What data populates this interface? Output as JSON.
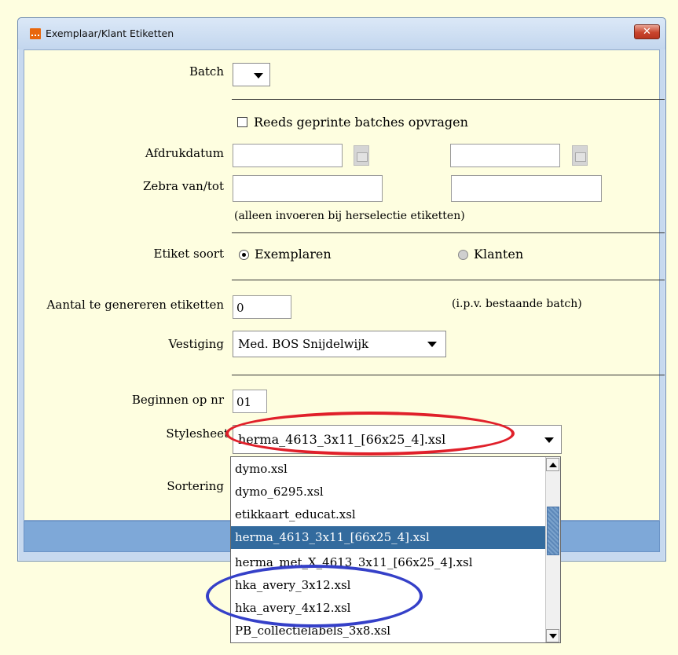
{
  "window": {
    "title": "Exemplaar/Klant Etiketten",
    "close_label": "✕"
  },
  "form": {
    "batch_label": "Batch",
    "reprint_checkbox_label": "Reeds geprinte batches opvragen",
    "print_date_label": "Afdrukdatum",
    "zebra_label": "Zebra van/tot",
    "reselect_hint": "(alleen invoeren bij herselectie etiketten)",
    "label_type_label": "Etiket soort",
    "label_type_options": [
      "Exemplaren",
      "Klanten"
    ],
    "count_label": "Aantal te genereren etiketten",
    "count_value": "0",
    "count_hint": "(i.p.v. bestaande batch)",
    "branch_label": "Vestiging",
    "branch_value": "Med. BOS Snijdelwijk",
    "start_label": "Beginnen op nr",
    "start_value": "01",
    "stylesheet_label": "Stylesheet",
    "stylesheet_value": "herma_4613_3x11_[66x25_4].xsl",
    "sort_label": "Sortering"
  },
  "stylesheet_options": [
    "dymo.xsl",
    "dymo_6295.xsl",
    "etikkaart_educat.xsl",
    "herma_4613_3x11_[66x25_4].xsl",
    "herma_met_X_4613_3x11_[66x25_4].xsl",
    "hka_avery_3x12.xsl",
    "hka_avery_4x12.xsl",
    "PB_collectielabels_3x8.xsl"
  ],
  "colors": {
    "highlight_red": "#e0202a",
    "highlight_blue": "#3540c8",
    "selected_option": "#336b9e"
  }
}
